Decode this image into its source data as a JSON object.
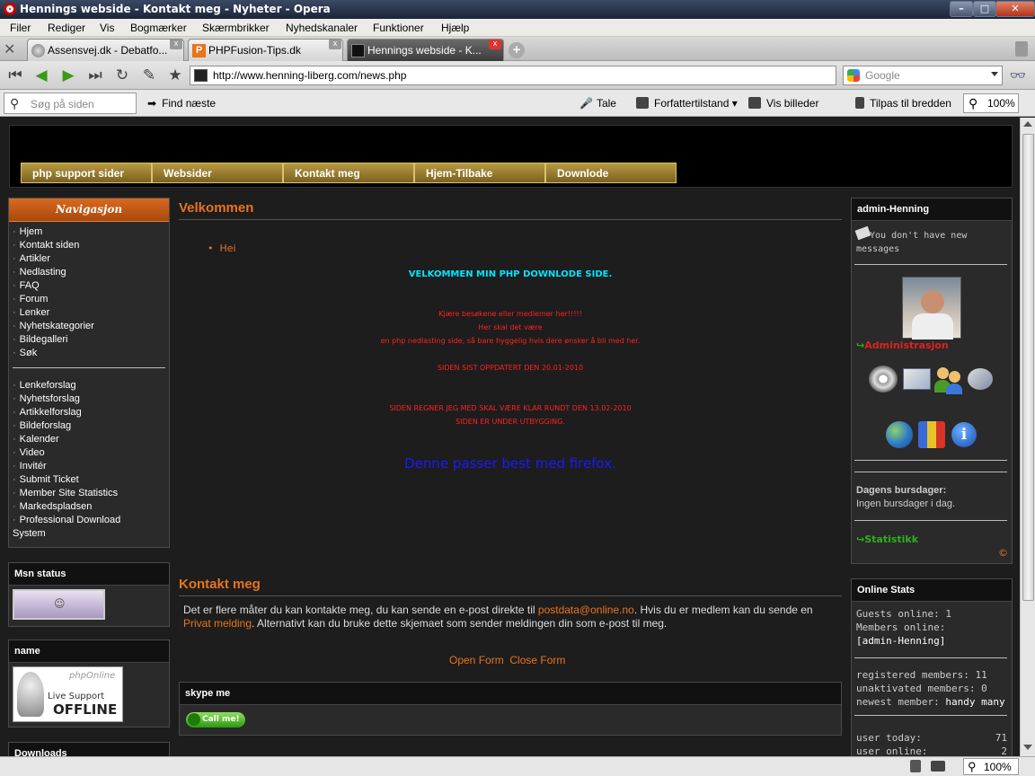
{
  "window": {
    "title": "Hennings webside - Kontakt meg - Nyheter - Opera"
  },
  "menu": [
    "Filer",
    "Rediger",
    "Vis",
    "Bogmærker",
    "Skærmbrikker",
    "Nyhedskanaler",
    "Funktioner",
    "Hjælp"
  ],
  "tabs": [
    {
      "label": "Assensvej.dk - Debatfo..."
    },
    {
      "label": "PHPFusion-Tips.dk"
    },
    {
      "label": "Hennings webside - K..."
    }
  ],
  "address": {
    "url": "http://www.henning-liberg.com/news.php",
    "search_placeholder": "Google"
  },
  "findbar": {
    "placeholder": "Søg på siden",
    "find_next": "Find næste",
    "speak": "Tale",
    "author_mode": "Forfattertilstand",
    "show_images": "Vis billeder",
    "fit_width": "Tilpas til bredden",
    "zoom": "100%"
  },
  "topnav": [
    "php support sider",
    "Websider",
    "Kontakt meg",
    "Hjem-Tilbake",
    "Downlode"
  ],
  "sidebar": {
    "heading": "Navigasjon",
    "group1": [
      "Hjem",
      "Kontakt siden",
      "Artikler",
      "Nedlasting",
      "FAQ",
      "Forum",
      "Lenker",
      "Nyhetskategorier",
      "Bildegalleri",
      "Søk"
    ],
    "group2": [
      "Lenkeforslag",
      "Nyhetsforslag",
      "Artikkelforslag",
      "Bildeforslag",
      "Kalender",
      "Video",
      "Invitér",
      "Submit Ticket",
      "Member Site Statistics",
      "Markedspladsen",
      "Professional Download"
    ],
    "group2_tail": "System",
    "msn_heading": "Msn status",
    "name_heading": "name",
    "downloads_heading": "Downloads",
    "livesupport": {
      "brand": "phpOnline",
      "line1": "Live Support",
      "line2": "OFFLINE"
    }
  },
  "welcome": {
    "title": "Velkommen",
    "bullet": "Hei",
    "headline": "VELKOMMEN MIN PHP DOWNLODE SIDE.",
    "line1": "Kjære besøkene eller medlemer her!!!!!",
    "line2": "Her skal det være",
    "line3": "en php nedlasting side, så bare hyggelig hvis dere ønsker å bli med her.",
    "updated": "SIDEN SIST OPPDATERT DEN 20.01-2010",
    "ready": "SIDEN REGNER JEG MED SKAL VÆRE KLAR RUNDT DEN 13.02-2010",
    "building": "SIDEN ER UNDER UTBYGGING.",
    "firefox": "Denne passer best med firefox."
  },
  "contact": {
    "title": "Kontakt meg",
    "text_a": "Det er flere måter du kan kontakte meg, du kan sende en e-post direkte til ",
    "email": "postdata@online.no",
    "text_b": ". Hvis du er medlem kan du sende en ",
    "pm": "Privat melding",
    "text_c": ". Alternativt kan du bruke dette skjemaet som sender meldingen din som e-post til meg.",
    "open_form": "Open Form",
    "close_form": "Close Form",
    "skype_heading": "skype me",
    "call_me": "Call me!"
  },
  "right": {
    "user_heading": "admin-Henning",
    "no_messages": "You don't have new messages",
    "admin_link": "Administrasjon",
    "birthdays_heading": "Dagens bursdager:",
    "birthdays_text": "Ingen bursdager i dag.",
    "stats_link": "Statistikk",
    "copyright": "©",
    "online_heading": "Online Stats",
    "guests": "Guests online: 1",
    "members_label": "Members online:",
    "members": "[admin-Henning]",
    "registered": "registered members: 11",
    "unactivated": "unaktivated members: 0",
    "newest_label": "newest member: ",
    "newest": "handy many",
    "user_today_label": "user today:",
    "user_today": "71",
    "user_online_label": "user online:",
    "user_online": "2"
  },
  "statusbar": {
    "zoom": "100%"
  },
  "colors": {
    "accent_orange": "#e8741c",
    "red_text": "#ff2020",
    "cyan_text": "#00e5ff",
    "blue_text": "#1a1aff",
    "green_link": "#2db01a"
  }
}
